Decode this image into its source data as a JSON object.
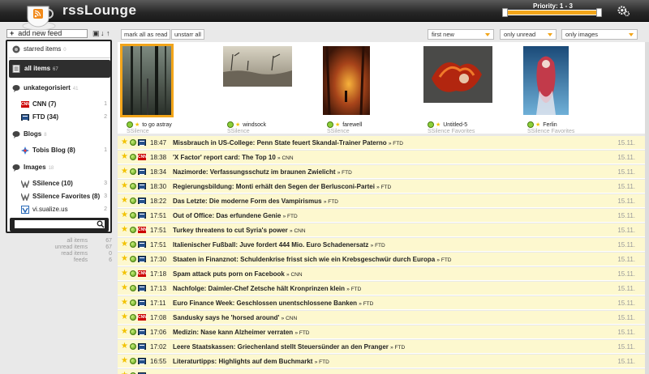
{
  "header": {
    "app_title": "rssLounge",
    "priority_label": "Priority: 1 - 3",
    "priority_range": [
      1,
      3
    ],
    "accent_color": "#f2a51a"
  },
  "sidebar": {
    "add_feed_label": "add new feed",
    "starred": {
      "label": "starred items",
      "count": "0"
    },
    "all_items": {
      "label": "all items",
      "count": "67"
    },
    "categories": [
      {
        "label": "unkategorisiert",
        "count": "41",
        "feeds": [
          {
            "label": "CNN (7)",
            "count": "1",
            "icon": "cnn-icon"
          },
          {
            "label": "FTD (34)",
            "count": "2",
            "icon": "ftd-icon"
          }
        ]
      },
      {
        "label": "Blogs",
        "count": "8",
        "feeds": [
          {
            "label": "Tobis Blog (8)",
            "count": "1",
            "icon": "tobis-blog-icon"
          }
        ]
      },
      {
        "label": "Images",
        "count": "18",
        "feeds": [
          {
            "label": "SSilence (10)",
            "count": "3",
            "icon": "ssilence-icon"
          },
          {
            "label": "SSilence Favorites (8)",
            "count": "3",
            "icon": "ssilence-icon"
          },
          {
            "label": "vi.sualize.us",
            "count": "2",
            "icon": "visualize-icon"
          }
        ]
      }
    ],
    "search_placeholder": ""
  },
  "stats": [
    {
      "label": "all items",
      "value": "67"
    },
    {
      "label": "unread items",
      "value": "67"
    },
    {
      "label": "read items",
      "value": "0"
    },
    {
      "label": "feeds",
      "value": "6"
    }
  ],
  "toolbar": {
    "mark_all_read": "mark all as read",
    "unstarr_all": "unstarr all",
    "sort_select": "first new",
    "filter_select": "only unread",
    "type_select": "only images"
  },
  "images": [
    {
      "title": "to go astray",
      "source": "SSilence"
    },
    {
      "title": "windsock",
      "source": "SSilence"
    },
    {
      "title": "farewell",
      "source": "SSilence"
    },
    {
      "title": "Untitled-5",
      "source": "SSilence Favorites"
    },
    {
      "title": "Ferlin",
      "source": "SSilence Favorites"
    }
  ],
  "items": [
    {
      "time": "18:47",
      "title": "Missbrauch in US-College: Penn State feuert Skandal-Trainer Paterno",
      "feed": "FTD",
      "date": "15.11.",
      "source": "ftd"
    },
    {
      "time": "18:38",
      "title": "'X Factor' report card: The Top 10",
      "feed": "CNN",
      "date": "15.11.",
      "source": "cnn"
    },
    {
      "time": "18:34",
      "title": "Nazimorde: Verfassungsschutz im braunen Zwielicht",
      "feed": "FTD",
      "date": "15.11.",
      "source": "ftd"
    },
    {
      "time": "18:30",
      "title": "Regierungsbildung: Monti erhält den Segen der Berlusconi-Partei",
      "feed": "FTD",
      "date": "15.11.",
      "source": "ftd"
    },
    {
      "time": "18:22",
      "title": "Das Letzte: Die moderne Form des Vampirismus",
      "feed": "FTD",
      "date": "15.11.",
      "source": "ftd"
    },
    {
      "time": "17:51",
      "title": "Out of Office: Das erfundene Genie",
      "feed": "FTD",
      "date": "15.11.",
      "source": "ftd"
    },
    {
      "time": "17:51",
      "title": "Turkey threatens to cut Syria's power",
      "feed": "CNN",
      "date": "15.11.",
      "source": "cnn"
    },
    {
      "time": "17:51",
      "title": "Italienischer Fußball: Juve fordert 444 Mio. Euro Schadenersatz",
      "feed": "FTD",
      "date": "15.11.",
      "source": "ftd"
    },
    {
      "time": "17:30",
      "title": "Staaten in Finanznot: Schuldenkrise frisst sich wie ein Krebsgeschwür durch Europa",
      "feed": "FTD",
      "date": "15.11.",
      "source": "ftd"
    },
    {
      "time": "17:18",
      "title": "Spam attack puts porn on Facebook",
      "feed": "CNN",
      "date": "15.11.",
      "source": "cnn"
    },
    {
      "time": "17:13",
      "title": "Nachfolge: Daimler-Chef Zetsche hält Kronprinzen klein",
      "feed": "FTD",
      "date": "15.11.",
      "source": "ftd"
    },
    {
      "time": "17:11",
      "title": "Euro Finance Week: Geschlossen unentschlossene Banken",
      "feed": "FTD",
      "date": "15.11.",
      "source": "ftd"
    },
    {
      "time": "17:08",
      "title": "Sandusky says he 'horsed around'",
      "feed": "CNN",
      "date": "15.11.",
      "source": "cnn"
    },
    {
      "time": "17:06",
      "title": "Medizin: Nase kann Alzheimer verraten",
      "feed": "FTD",
      "date": "15.11.",
      "source": "ftd"
    },
    {
      "time": "17:02",
      "title": "Leere Staatskassen: Griechenland stellt Steuersünder an den Pranger",
      "feed": "FTD",
      "date": "15.11.",
      "source": "ftd"
    },
    {
      "time": "16:55",
      "title": "Literaturtipps: Highlights auf dem Buchmarkt",
      "feed": "FTD",
      "date": "15.11.",
      "source": "ftd"
    },
    {
      "time": "",
      "title": "",
      "feed": "",
      "date": "",
      "source": "ftd"
    }
  ]
}
